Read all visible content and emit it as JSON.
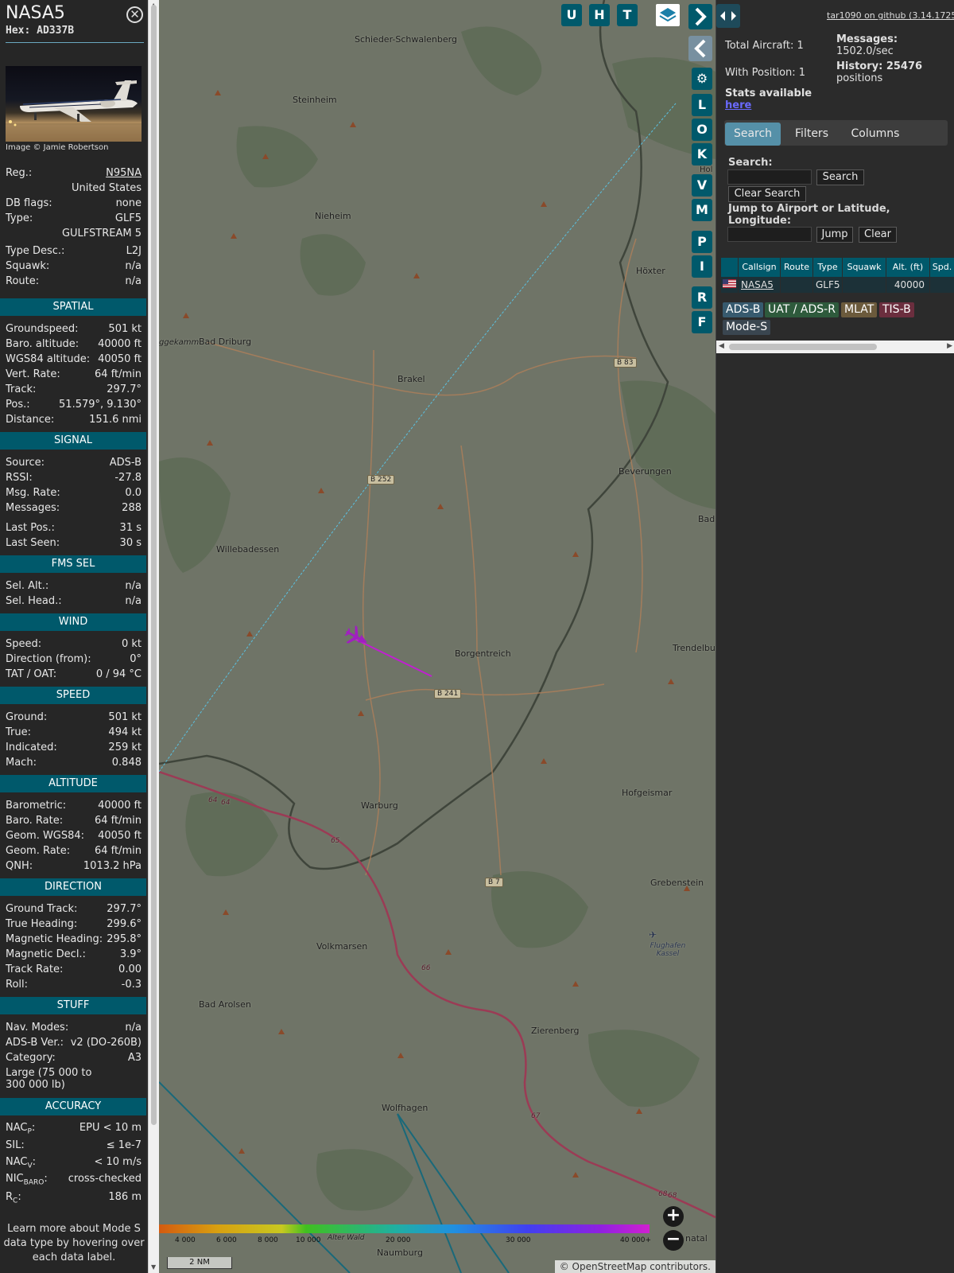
{
  "aircraft": {
    "callsign": "NASA5",
    "hex_label": "Hex: AD337B",
    "photo_credit": "Image © Jamie Robertson"
  },
  "info_rows_top": [
    {
      "label": "Reg.:",
      "value": "N95NA"
    },
    {
      "label": "",
      "value": "United States"
    },
    {
      "label": "DB flags:",
      "value": "none"
    },
    {
      "label": "Type:",
      "value": "GLF5"
    },
    {
      "label": "",
      "value": "GULFSTREAM 5"
    },
    {
      "label": "Type Desc.:",
      "value": "L2J"
    },
    {
      "label": "Squawk:",
      "value": "n/a"
    },
    {
      "label": "Route:",
      "value": "n/a"
    }
  ],
  "sections": {
    "spatial": {
      "title": "SPATIAL",
      "rows": [
        {
          "label": "Groundspeed:",
          "value": "501 kt"
        },
        {
          "label": "Baro. altitude:",
          "value": "40000 ft"
        },
        {
          "label": "WGS84 altitude:",
          "value": "40050 ft"
        },
        {
          "label": "Vert. Rate:",
          "value": "64 ft/min"
        },
        {
          "label": "Track:",
          "value": "297.7°"
        },
        {
          "label": "Pos.:",
          "value": "51.579°, 9.130°"
        },
        {
          "label": "Distance:",
          "value": "151.6 nmi"
        }
      ]
    },
    "signal": {
      "title": "SIGNAL",
      "rows": [
        {
          "label": "Source:",
          "value": "ADS-B"
        },
        {
          "label": "RSSI:",
          "value": "-27.8"
        },
        {
          "label": "Msg. Rate:",
          "value": "0.0"
        },
        {
          "label": "Messages:",
          "value": "288"
        },
        {
          "label": "Last Pos.:",
          "value": "31 s"
        },
        {
          "label": "Last Seen:",
          "value": "30 s"
        }
      ]
    },
    "fms": {
      "title": "FMS SEL",
      "rows": [
        {
          "label": "Sel. Alt.:",
          "value": "n/a"
        },
        {
          "label": "Sel. Head.:",
          "value": "n/a"
        }
      ]
    },
    "wind": {
      "title": "WIND",
      "rows": [
        {
          "label": "Speed:",
          "value": "0 kt"
        },
        {
          "label": "Direction (from):",
          "value": "0°"
        },
        {
          "label": "TAT / OAT:",
          "value": "0 / 94 °C"
        }
      ]
    },
    "speed": {
      "title": "SPEED",
      "rows": [
        {
          "label": "Ground:",
          "value": "501 kt"
        },
        {
          "label": "True:",
          "value": "494 kt"
        },
        {
          "label": "Indicated:",
          "value": "259 kt"
        },
        {
          "label": "Mach:",
          "value": "0.848"
        }
      ]
    },
    "altitude": {
      "title": "ALTITUDE",
      "rows": [
        {
          "label": "Barometric:",
          "value": "40000 ft"
        },
        {
          "label": "Baro. Rate:",
          "value": "64 ft/min"
        },
        {
          "label": "Geom. WGS84:",
          "value": "40050 ft"
        },
        {
          "label": "Geom. Rate:",
          "value": "64 ft/min"
        },
        {
          "label": "QNH:",
          "value": "1013.2 hPa"
        }
      ]
    },
    "direction": {
      "title": "DIRECTION",
      "rows": [
        {
          "label": "Ground Track:",
          "value": "297.7°"
        },
        {
          "label": "True Heading:",
          "value": "299.6°"
        },
        {
          "label": "Magnetic Heading:",
          "value": "295.8°"
        },
        {
          "label": "Magnetic Decl.:",
          "value": "3.9°"
        },
        {
          "label": "Track Rate:",
          "value": "0.00"
        },
        {
          "label": "Roll:",
          "value": "-0.3"
        }
      ]
    },
    "stuff": {
      "title": "STUFF",
      "rows": [
        {
          "label": "Nav. Modes:",
          "value": "n/a"
        },
        {
          "label": "ADS-B Ver.:",
          "value": "v2 (DO-260B)"
        },
        {
          "label": "Category:",
          "value": "A3"
        }
      ],
      "category_desc": "Large (75 000 to 300 000 lb)"
    },
    "accuracy": {
      "title": "ACCURACY",
      "rows": [
        {
          "label": "NAC",
          "sub": "P",
          "suffix": ":",
          "value": "EPU < 10 m"
        },
        {
          "label": "SIL:",
          "sub": "",
          "suffix": "",
          "value": "≤ 1e-7"
        },
        {
          "label": "NAC",
          "sub": "V",
          "suffix": ":",
          "value": "< 10 m/s"
        },
        {
          "label": "NIC",
          "sub": "BARO",
          "suffix": ":",
          "value": "cross-checked"
        },
        {
          "label": "R",
          "sub": "C",
          "suffix": ":",
          "value": "186 m"
        }
      ]
    }
  },
  "learn_more": "Learn more about Mode S data type by hovering over each data label.",
  "map": {
    "towns": [
      "Schieder-Schwalenberg",
      "Steinheim",
      "Nieheim",
      "Bad Driburg",
      "Brakel",
      "Höxter",
      "Beverungen",
      "Willebadessen",
      "Borgentreich",
      "Trendelbur",
      "Warburg",
      "Hofgeismar",
      "Volkmarsen",
      "Grebenstein",
      "Bad Arolsen",
      "Zierenberg",
      "Wolfhagen",
      "Naumburg",
      "Bad",
      "Hol",
      "ggekamm",
      "Flughafen Kassel",
      "Alter Wald",
      "natal"
    ],
    "road_shields": [
      "B 83",
      "B 252",
      "B 241",
      "B 7"
    ],
    "motorway_numbers": [
      "64",
      "64",
      "65",
      "66",
      "67",
      "68",
      "68"
    ],
    "buttons": {
      "u": "U",
      "h": "H",
      "t": "T",
      "l": "L",
      "o": "O",
      "k": "K",
      "v": "V",
      "m": "M",
      "p": "P",
      "i": "I",
      "r": "R",
      "f": "F"
    },
    "altitude_scale": [
      "4 000",
      "6 000",
      "8 000",
      "10 000",
      "20 000",
      "30 000",
      "40 000+"
    ],
    "scale_label": "2 NM",
    "attribution_prefix": "©",
    "attribution_link": "OpenStreetMap",
    "attribution_suffix": "contributors.",
    "track_color": "#c020d0",
    "aircraft_color": "#a020c0"
  },
  "stats": {
    "github_link": "tar1090 on github (3.14.1725)",
    "total_aircraft": "Total Aircraft: 1",
    "with_position": "With Position: 1",
    "stats_available": "Stats available",
    "here": "here",
    "messages_label": "Messages:",
    "messages_value": "1502.0/sec",
    "history_label": "History: 25476",
    "history_value": "positions"
  },
  "tabs": [
    "Search",
    "Filters",
    "Columns"
  ],
  "search": {
    "label": "Search:",
    "search_button": "Search",
    "clear_search_button": "Clear Search",
    "jump_label": "Jump to Airport or Latitude, Longitude:",
    "jump_button": "Jump",
    "clear_button": "Clear"
  },
  "table": {
    "headers": [
      "",
      "Callsign",
      "Route",
      "Type",
      "Squawk",
      "Alt. (ft)",
      "Spd."
    ],
    "row": {
      "callsign": "NASA5",
      "route": "",
      "type": "GLF5",
      "squawk": "",
      "alt": "40000",
      "spd": ""
    }
  },
  "legend": {
    "adsb": "ADS-B",
    "uat": "UAT / ADS-R",
    "mlat": "MLAT",
    "tisb": "TIS-B",
    "modes": "Mode-S"
  }
}
